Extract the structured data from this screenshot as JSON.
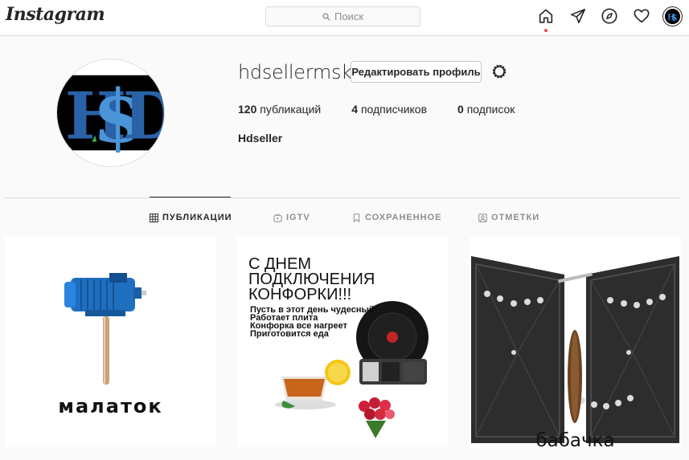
{
  "nav": {
    "logo": "Instagram",
    "search_placeholder": "Поиск",
    "icons": [
      "home-icon",
      "direct-icon",
      "explore-icon",
      "activity-icon",
      "avatar"
    ]
  },
  "profile": {
    "username": "hdsellermsk",
    "edit_label": "Редактировать профиль",
    "posts_count": "120",
    "posts_label": "публикаций",
    "followers_count": "4",
    "followers_label": "подписчиков",
    "following_count": "0",
    "following_label": "подписок",
    "full_name": "Hdseller",
    "avatar_letters": "HSD"
  },
  "tabs": [
    {
      "label": "ПУБЛИКАЦИИ",
      "icon": "grid-icon",
      "active": true
    },
    {
      "label": "IGTV",
      "icon": "igtv-icon",
      "active": false
    },
    {
      "label": "СОХРАНЕННОЕ",
      "icon": "bookmark-icon",
      "active": false
    },
    {
      "label": "ОТМЕТКИ",
      "icon": "tagged-icon",
      "active": false
    }
  ],
  "posts": [
    {
      "caption": "малаток"
    },
    {
      "title": "С ДНЕМ\nПОДКЛЮЧЕНИЯ\nКОНФОРКИ!!!",
      "body": "Пусть в этот день чудесный\nРаботает плита\nКонфорка все нагреет\nПриготовится еда"
    },
    {
      "caption": "бабачка"
    }
  ],
  "colors": {
    "accent_dot": "#ed4956",
    "border": "#dbdbdb",
    "text": "#262626",
    "muted": "#8e8e8e"
  }
}
